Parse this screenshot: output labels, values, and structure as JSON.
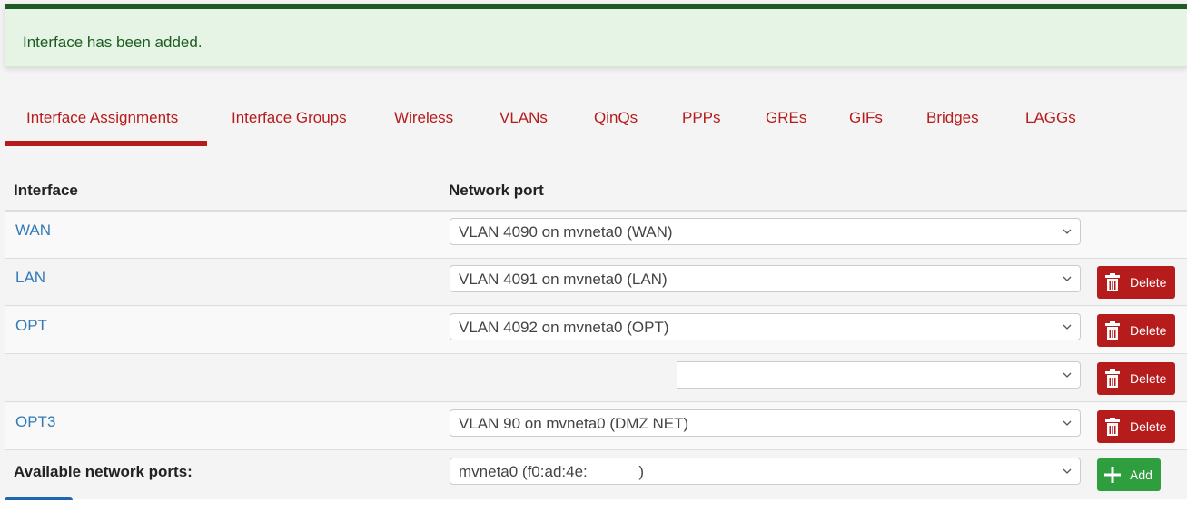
{
  "alert": {
    "message": "Interface has been added.",
    "color": "#1e5c1f"
  },
  "tabs": [
    {
      "label": "Interface Assignments",
      "active": true
    },
    {
      "label": "Interface Groups",
      "active": false
    },
    {
      "label": "Wireless",
      "active": false
    },
    {
      "label": "VLANs",
      "active": false
    },
    {
      "label": "QinQs",
      "active": false
    },
    {
      "label": "PPPs",
      "active": false
    },
    {
      "label": "GREs",
      "active": false
    },
    {
      "label": "GIFs",
      "active": false
    },
    {
      "label": "Bridges",
      "active": false
    },
    {
      "label": "LAGGs",
      "active": false
    }
  ],
  "table": {
    "headers": {
      "interface": "Interface",
      "network_port": "Network port"
    },
    "rows": [
      {
        "interface": "WAN",
        "port": "VLAN 4090 on mvneta0 (WAN)",
        "action": null
      },
      {
        "interface": "LAN",
        "port": "VLAN 4091 on mvneta0 (LAN)",
        "action": "Delete"
      },
      {
        "interface": "OPT",
        "port": "VLAN 4092 on mvneta0 (OPT)",
        "action": "Delete"
      },
      {
        "interface": "",
        "port": "",
        "action": "Delete"
      },
      {
        "interface": "OPT3",
        "port": "VLAN 90 on mvneta0 (DMZ NET)",
        "action": "Delete"
      }
    ],
    "available": {
      "label": "Available network ports:",
      "port": "mvneta0 (f0:ad:4e:            )",
      "action": "Add"
    }
  },
  "colors": {
    "accent": "#b71c1c",
    "link": "#337ab7",
    "add": "#2e9e3e"
  }
}
